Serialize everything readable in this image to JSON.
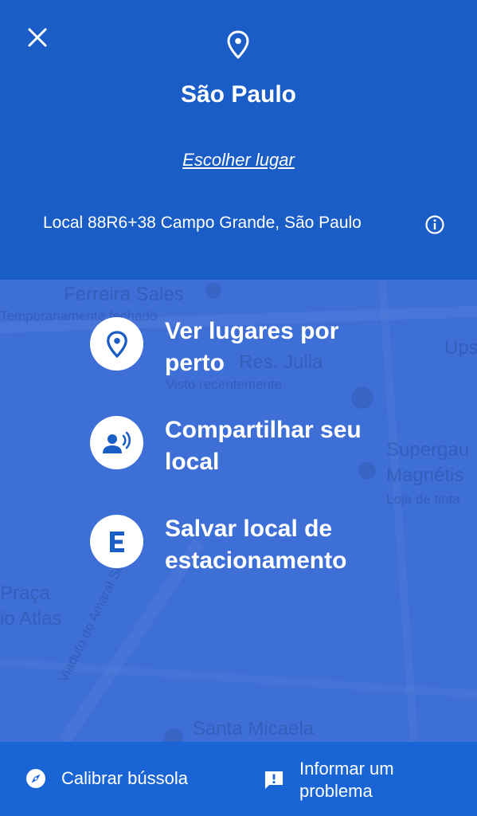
{
  "header": {
    "title": "São Paulo",
    "choose_place": "Escolher lugar",
    "location": "Local 88R6+38 Campo Grande, São Paulo",
    "background": "#1a5dc6"
  },
  "map": {
    "labels": [
      "Ferreira Sales",
      "Temporariamente fechado",
      "Res. Julia",
      "Visto recentemente",
      "Ups",
      "Supergau",
      "Magnétis",
      "Loja de tinta",
      "Praça",
      "io Atlas",
      "Santa Micaela",
      "Viaduto do Amaral Souza"
    ]
  },
  "actions": [
    {
      "label": "Ver lugares por perto",
      "icon": "location-pin-icon"
    },
    {
      "label": "Compartilhar seu local",
      "icon": "share-location-person-icon"
    },
    {
      "label": "Salvar local de estacionamento",
      "icon": "parking-e-icon"
    }
  ],
  "bottom": {
    "calibrate": "Calibrar bússola",
    "report": "Informar um problema",
    "background": "#1a65d6"
  }
}
